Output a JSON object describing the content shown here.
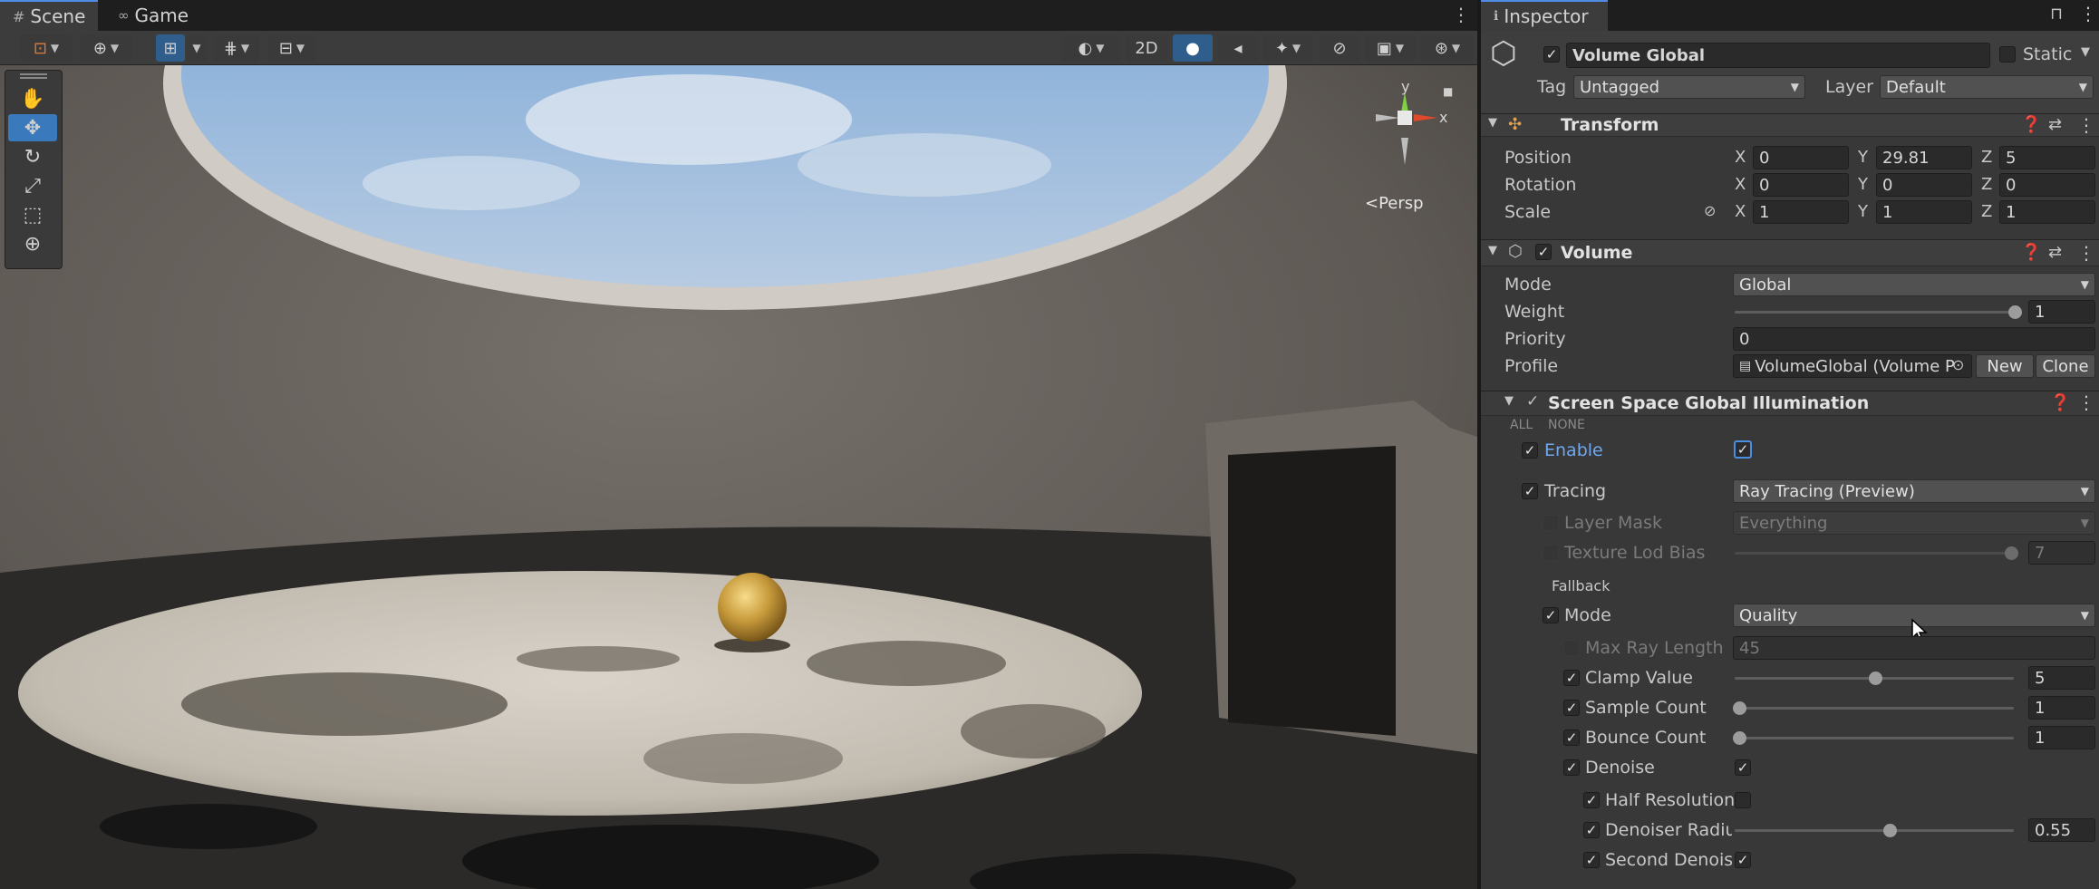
{
  "scene_window": {
    "tabs": [
      {
        "label": "Scene",
        "icon": "hash-icon"
      },
      {
        "label": "Game",
        "icon": "gamepad-icon"
      }
    ],
    "toolbar": {
      "mode_2d_label": "2D"
    },
    "view_label": "<Persp",
    "gizmo_axes": {
      "y": "y",
      "x": "x"
    }
  },
  "inspector": {
    "tab_label": "Inspector",
    "object": {
      "name": "Volume Global",
      "static_label": "Static",
      "tag_label": "Tag",
      "tag_value": "Untagged",
      "layer_label": "Layer",
      "layer_value": "Default"
    },
    "transform": {
      "title": "Transform",
      "position": {
        "label": "Position",
        "x": "0",
        "y": "29.81",
        "z": "5"
      },
      "rotation": {
        "label": "Rotation",
        "x": "0",
        "y": "0",
        "z": "0"
      },
      "scale": {
        "label": "Scale",
        "x": "1",
        "y": "1",
        "z": "1"
      },
      "axis_x": "X",
      "axis_y": "Y",
      "axis_z": "Z"
    },
    "volume": {
      "title": "Volume",
      "mode_label": "Mode",
      "mode_value": "Global",
      "weight_label": "Weight",
      "weight_value": "1",
      "priority_label": "Priority",
      "priority_value": "0",
      "profile_label": "Profile",
      "profile_value": "VolumeGlobal (Volume P",
      "new_label": "New",
      "clone_label": "Clone"
    },
    "ssgi": {
      "title": "Screen Space Global Illumination",
      "all_label": "ALL",
      "none_label": "NONE",
      "enable_label": "Enable",
      "tracing_label": "Tracing",
      "tracing_value": "Ray Tracing (Preview)",
      "layer_mask_label": "Layer Mask",
      "layer_mask_value": "Everything",
      "texture_lod_label": "Texture Lod Bias",
      "texture_lod_value": "7",
      "fallback_label": "Fallback",
      "fallback_mode_label": "Mode",
      "fallback_mode_value": "Quality",
      "max_ray_label": "Max Ray Length",
      "max_ray_value": "45",
      "clamp_label": "Clamp Value",
      "clamp_value": "5",
      "sample_label": "Sample Count",
      "sample_value": "1",
      "bounce_label": "Bounce Count",
      "bounce_value": "1",
      "denoise_label": "Denoise",
      "half_res_label": "Half Resolution",
      "denoiser_radius_label": "Denoiser Radius",
      "denoiser_radius_value": "0.55",
      "second_denoise_label": "Second Denoiser"
    }
  }
}
